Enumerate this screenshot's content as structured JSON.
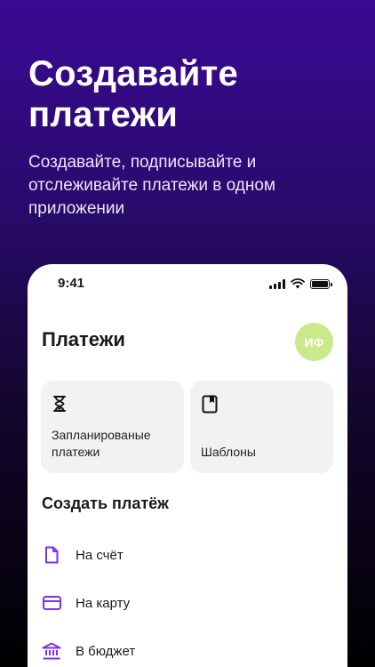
{
  "promo": {
    "title": "Создавайте платежи",
    "subtitle": "Создавайте, подписывайте и отслеживайте платежи в одном приложении"
  },
  "phone": {
    "status_time": "9:41",
    "screen_title": "Платежи",
    "avatar_initials": "ИФ",
    "cards": [
      {
        "label": "Запланированые платежи",
        "icon": "hourglass-icon"
      },
      {
        "label": "Шаблоны",
        "icon": "book-icon"
      }
    ],
    "section_title": "Создать платёж",
    "items": [
      {
        "label": "На счёт",
        "icon": "document-icon"
      },
      {
        "label": "На карту",
        "icon": "card-icon"
      },
      {
        "label": "В бюджет",
        "icon": "bank-icon"
      }
    ]
  },
  "colors": {
    "accent": "#7b2ff0",
    "avatar_bg": "#c8ea8a",
    "card_bg": "#f2f2f4",
    "bg_top": "#3a0a93"
  }
}
